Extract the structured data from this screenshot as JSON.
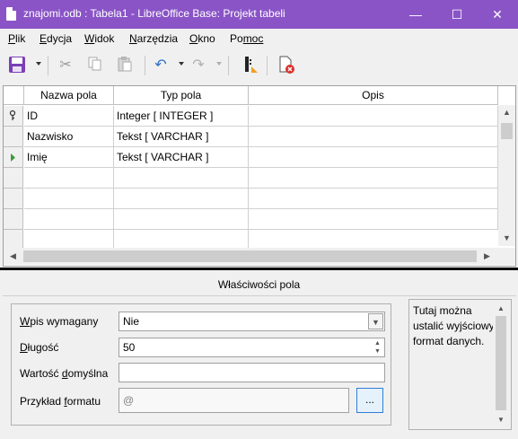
{
  "window": {
    "title": "znajomi.odb : Tabela1 - LibreOffice Base: Projekt tabeli",
    "minimize_glyph": "—",
    "maximize_glyph": "☐",
    "close_glyph": "✕"
  },
  "menu": {
    "items": [
      {
        "u": "P",
        "rest": "lik"
      },
      {
        "u": "E",
        "rest": "dycja"
      },
      {
        "u": "W",
        "rest": "idok"
      },
      {
        "u": "N",
        "rest": "arzędzia"
      },
      {
        "u": "O",
        "rest": "kno"
      },
      {
        "u": "Po",
        "rest": "moc",
        "u_at_end": true
      }
    ],
    "labels": [
      "Plik",
      "Edycja",
      "Widok",
      "Narzędzia",
      "Okno",
      "Pomoc"
    ]
  },
  "toolbar": {
    "icons": [
      "save-icon",
      "cut-icon",
      "copy-icon",
      "paste-icon",
      "undo-icon",
      "redo-icon",
      "index-design-icon",
      "delete-icon"
    ],
    "colors": {
      "save": "#7b3fb6",
      "delete": "#d9302c",
      "accent": "#8a54c7"
    }
  },
  "grid": {
    "columns": [
      "Nazwa pola",
      "Typ pola",
      "Opis"
    ],
    "rows": [
      {
        "name": "ID",
        "type": "Integer [ INTEGER ]",
        "desc": "",
        "marker": "key"
      },
      {
        "name": "Nazwisko",
        "type": "Tekst [ VARCHAR ]",
        "desc": "",
        "marker": ""
      },
      {
        "name": "Imię",
        "type": "Tekst [ VARCHAR ]",
        "desc": "",
        "marker": "current"
      },
      {
        "name": "",
        "type": "",
        "desc": "",
        "marker": ""
      },
      {
        "name": "",
        "type": "",
        "desc": "",
        "marker": ""
      },
      {
        "name": "",
        "type": "",
        "desc": "",
        "marker": ""
      },
      {
        "name": "",
        "type": "",
        "desc": "",
        "marker": ""
      }
    ]
  },
  "properties": {
    "title": "Właściwości pola",
    "required_label_u": "W",
    "required_label_rest": "pis wymagany",
    "required_value": "Nie",
    "length_label_u": "D",
    "length_label_rest": "ługość",
    "length_value": "50",
    "default_label_pre": "Wartość ",
    "default_label_u": "d",
    "default_label_rest": "omyślna",
    "default_value": "",
    "format_label_pre": "Przykład ",
    "format_label_u": "f",
    "format_label_rest": "ormatu",
    "format_value": "@",
    "format_button": "..."
  },
  "help": {
    "text": "Tutaj można ustalić wyjściowy format danych."
  }
}
